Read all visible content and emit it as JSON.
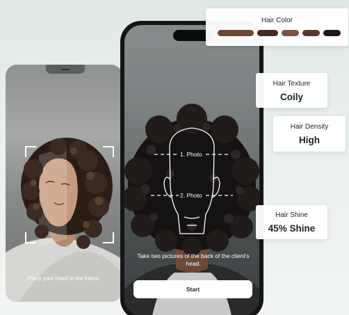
{
  "left_phone": {
    "instruction": "Place your head in the frame."
  },
  "main_phone": {
    "photo_labels": [
      "1. Photo",
      "2. Photo"
    ],
    "instruction": "Take two pictures of the back of the client's head.",
    "start_label": "Start"
  },
  "cards": {
    "hair_color": {
      "label": "Hair Color",
      "swatches": [
        "#6e4636",
        "#43291f",
        "#7d5242",
        "#58392d",
        "#211614"
      ]
    },
    "texture": {
      "label": "Hair Texture",
      "value": "Coily"
    },
    "density": {
      "label": "Hair Density",
      "value": "High"
    },
    "shine": {
      "label": "Hair Shine",
      "value": "45% Shine"
    }
  }
}
